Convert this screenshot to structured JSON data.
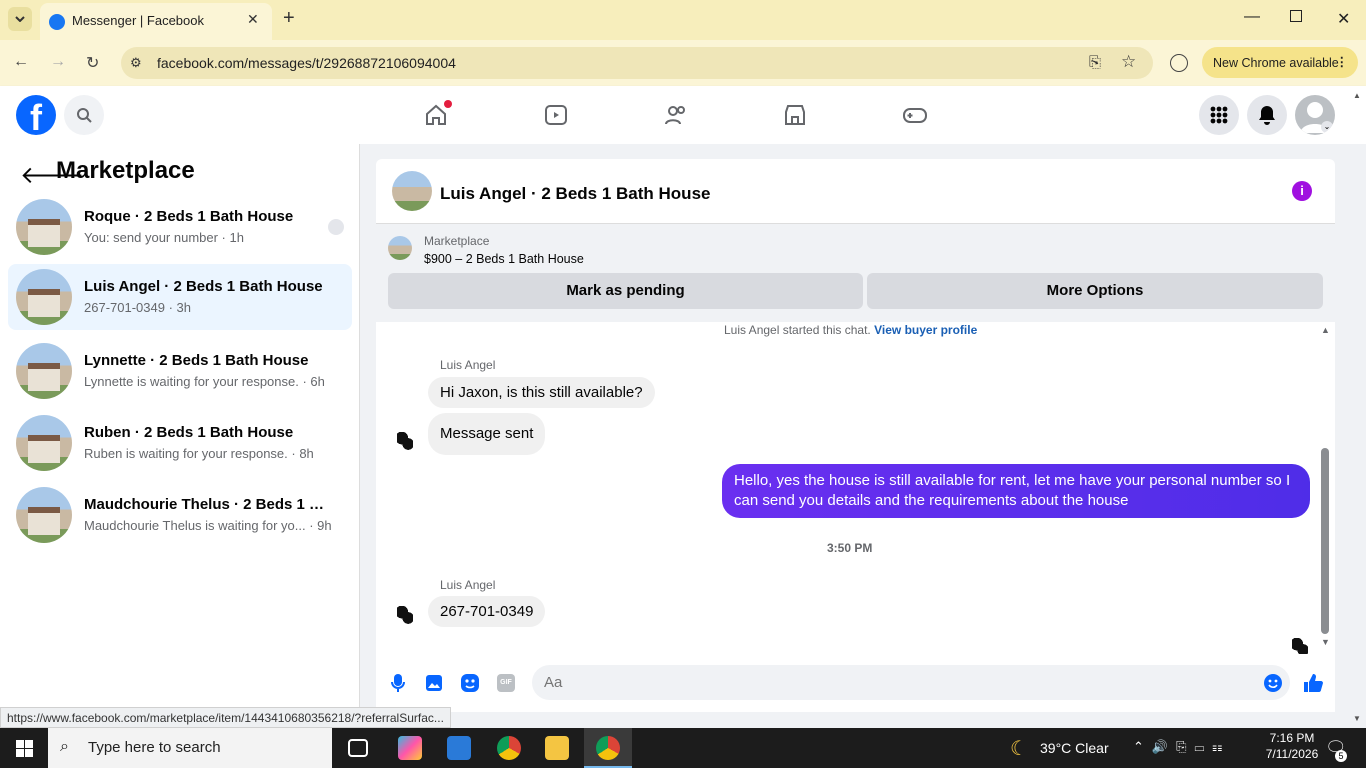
{
  "browser": {
    "tab_title": "Messenger | Facebook",
    "url": "facebook.com/messages/t/29268872106094004",
    "chrome_pill": "New Chrome available",
    "status_url": "https://www.facebook.com/marketplace/item/1443410680356218/?referralSurfac..."
  },
  "sidebar": {
    "title": "Marketplace",
    "conversations": [
      {
        "name": "Roque · 2 Beds 1 Bath House",
        "sub": "You: send your number · 1h"
      },
      {
        "name": "Luis Angel · 2 Beds 1 Bath House",
        "sub": "267-701-0349 · 3h"
      },
      {
        "name": "Lynnette · 2 Beds 1 Bath House",
        "sub": "Lynnette is waiting for your response. · 6h"
      },
      {
        "name": "Ruben · 2 Beds 1 Bath House",
        "sub": "Ruben is waiting for your response. · 8h"
      },
      {
        "name": "Maudchourie Thelus · 2 Beds 1 Bat...",
        "sub": "Maudchourie Thelus is waiting for yo...   · 9h"
      }
    ]
  },
  "chat": {
    "title": "Luis Angel · 2 Beds 1 Bath House",
    "marketplace_label": "Marketplace",
    "listing": "$900 – 2 Beds 1 Bath House",
    "btn_pending": "Mark as pending",
    "btn_more": "More Options",
    "started": "Luis Angel started this chat.",
    "view_profile": "View buyer profile",
    "sender1": "Luis Angel",
    "msg1": "Hi Jaxon, is this still available?",
    "msg2": "Message sent",
    "msg_out": "Hello, yes the house is still available for rent, let me have your personal number so I can send you details and the requirements about the house",
    "time": "3:50 PM",
    "sender2": "Luis Angel",
    "msg3": "267-701-0349",
    "placeholder": "Aa"
  },
  "taskbar": {
    "search": "Type here to search",
    "weather": "39°C  Clear",
    "time": "7:16 PM",
    "date": "7/11/2026",
    "notif": "5"
  }
}
